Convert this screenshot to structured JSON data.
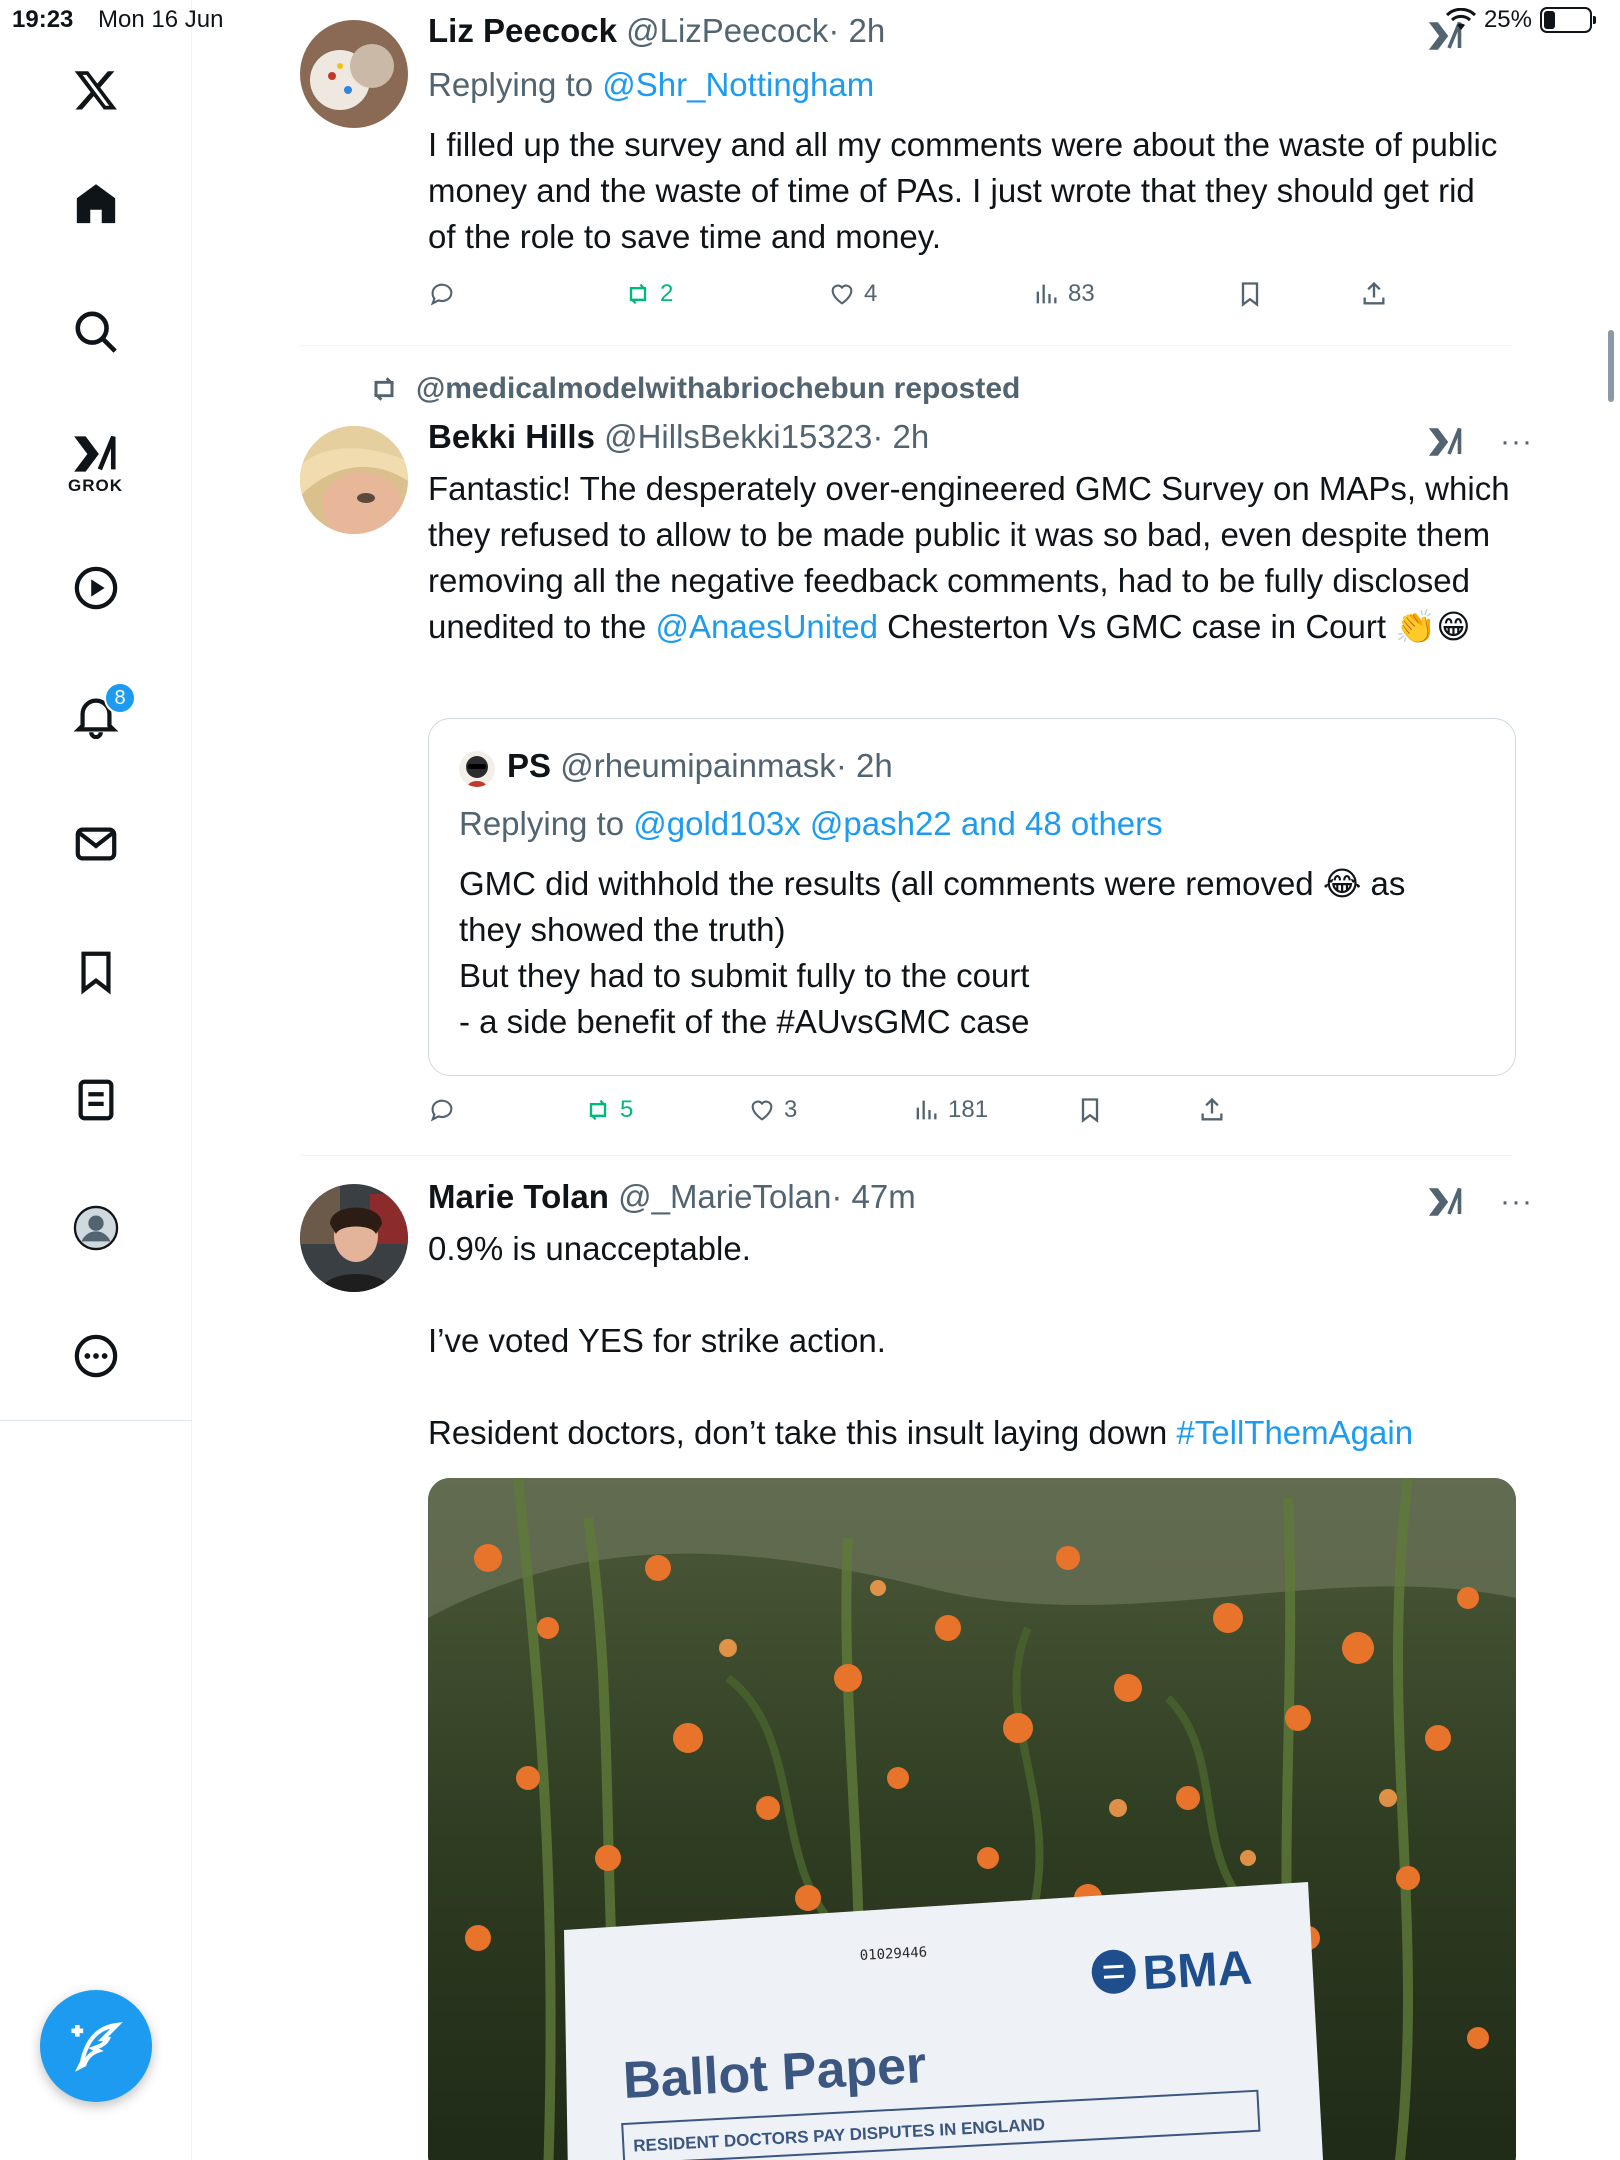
{
  "status_bar": {
    "time": "19:23",
    "date": "Mon 16 Jun",
    "battery": "25%",
    "battery_level": 0.25
  },
  "sidebar": {
    "grok_label": "GROK",
    "notifications_badge": "8"
  },
  "tweets": [
    {
      "name": "Liz Peecock",
      "handle": "@LizPeecock",
      "time": "· 2h",
      "reply_prefix": "Replying to ",
      "reply_to": "@Shr_Nottingham",
      "text": [
        "I filled up the survey and all my comments were about the waste of public money and the waste of time of PAs.  I just wrote that they should get rid of the role to save time and money."
      ],
      "reposts": "2",
      "likes": "4",
      "views": "83"
    },
    {
      "repost_by": "@medicalmodelwithabriochebun reposted",
      "name": "Bekki Hills",
      "handle": "@HillsBekki15323",
      "time": "· 2h",
      "text_before": "Fantastic! The desperately over-engineered GMC Survey on MAPs, which they refused to allow to be made public it was so bad, even despite them removing all the negative feedback comments, had to be fully disclosed unedited to the ",
      "text_link": "@AnaesUnited",
      "text_after": " Chesterton Vs GMC case in Court 👏😁",
      "quote": {
        "name": "PS",
        "handle": "@rheumipainmask",
        "time": "· 2h",
        "reply_prefix": "Replying to ",
        "reply_to": "@gold103x @pash22 and 48 others",
        "lines": [
          "GMC did withhold the results (all comments were removed 😂 as they showed the truth)",
          "But they had to submit fully to the court",
          "- a side benefit of the #AUvsGMC  case"
        ]
      },
      "reposts": "5",
      "likes": "3",
      "views": "181"
    },
    {
      "name": "Marie Tolan",
      "handle": "@_MarieTolan",
      "time": "· 47m",
      "line1": "0.9% is unacceptable.",
      "line2": "I’ve voted YES for strike action.",
      "line3_text": "Resident doctors, don’t take this insult laying down ",
      "line3_hashtag": "#TellThemAgain",
      "image": {
        "ballot_number": "01029446",
        "brand": "BMA",
        "title": "Ballot Paper",
        "subtitle": "RESIDENT DOCTORS PAY DISPUTES IN ENGLAND"
      }
    }
  ],
  "colors": {
    "accent": "#1d9bf0",
    "repost_green": "#00ba7c",
    "muted": "#536471"
  }
}
